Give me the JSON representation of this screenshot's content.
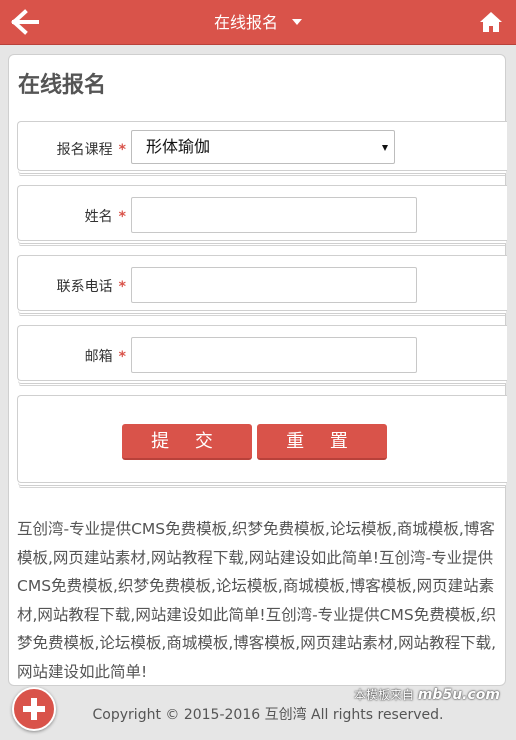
{
  "header": {
    "title": "在线报名",
    "back_icon": "arrow-left-icon",
    "home_icon": "home-icon",
    "caret_icon": "caret-down-icon"
  },
  "form": {
    "page_title": "在线报名",
    "required_mark": "*",
    "course": {
      "label": "报名课程",
      "selected": "形体瑜伽"
    },
    "name": {
      "label": "姓名",
      "value": ""
    },
    "phone": {
      "label": "联系电话",
      "value": ""
    },
    "email": {
      "label": "邮箱",
      "value": ""
    },
    "submit_label": "提 交",
    "reset_label": "重 置"
  },
  "description": "互创湾-专业提供CMS免费模板,织梦免费模板,论坛模板,商城模板,博客模板,网页建站素材,网站教程下载,网站建设如此简单!互创湾-专业提供CMS免费模板,织梦免费模板,论坛模板,商城模板,博客模板,网页建站素材,网站教程下载,网站建设如此简单!互创湾-专业提供CMS免费模板,织梦免费模板,论坛模板,商城模板,博客模板,网页建站素材,网站教程下载,网站建设如此简单!",
  "watermark": {
    "prefix": "本模板来自",
    "brand": "mb5u.com"
  },
  "footer": {
    "copyright": "Copyright © 2015-2016 互创湾 All rights reserved."
  },
  "colors": {
    "accent": "#d9534a",
    "background": "#e6e6e6",
    "card": "#ffffff"
  }
}
